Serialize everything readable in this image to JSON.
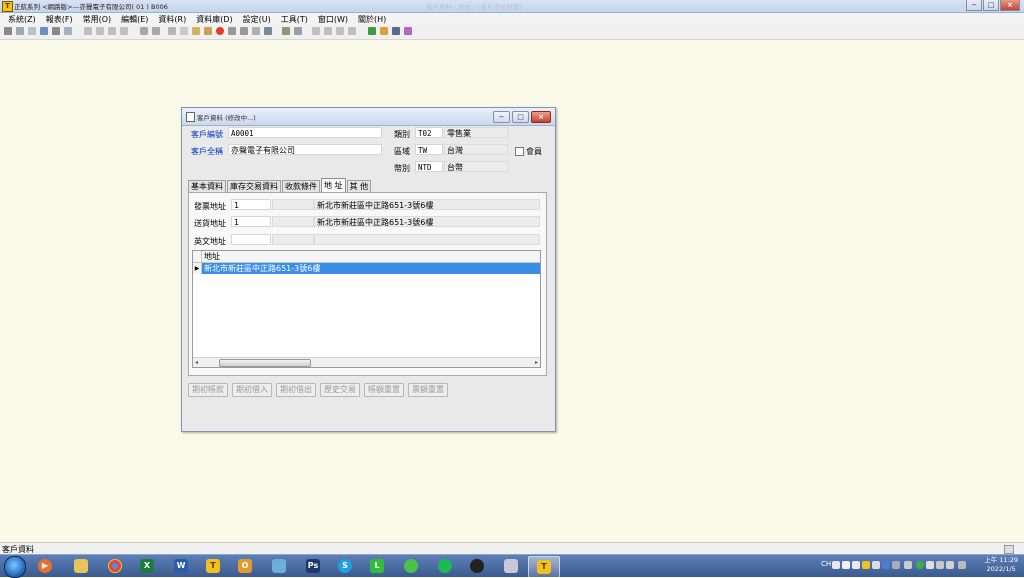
{
  "window": {
    "title": "正航系列 <網路版>---亦聲電子有限公司( 01 ) B006",
    "ghost_title": "客戶資料 - 地址 - [客戶地址維護]",
    "buttons": [
      "−",
      "□",
      "×"
    ]
  },
  "menu": [
    "系統(Z)",
    "報表(F)",
    "常用(O)",
    "編輯(E)",
    "資料(R)",
    "資料庫(D)",
    "設定(U)",
    "工具(T)",
    "窗口(W)",
    "關於(H)"
  ],
  "dialog": {
    "title": "客戶資料 (修改中...)",
    "buttons": [
      "−",
      "□",
      "×"
    ],
    "customer_no_label": "客戶編號",
    "customer_no": "A0001",
    "customer_name_label": "客戶全稱",
    "customer_name": "亦聲電子有限公司",
    "category_label": "類別",
    "category_code": "T02",
    "category_name": "零售業",
    "region_label": "區域",
    "region_code": "TW",
    "region_name": "台灣",
    "currency_label": "幣別",
    "currency_code": "NTD",
    "currency_name": "台幣",
    "member_label": "會員",
    "tabs": [
      "基本資料",
      "庫存交易資料",
      "收款條件",
      "地  址",
      "其  他"
    ],
    "active_tab": "地  址",
    "address": {
      "invoice_label": "發票地址",
      "invoice_code": "1",
      "invoice_address": "新北市新莊區中正路651-3號6樓",
      "delivery_label": "送貨地址",
      "delivery_code": "1",
      "delivery_address": "新北市新莊區中正路651-3號6樓",
      "english_label": "英文地址",
      "english_code": "",
      "english_address": ""
    },
    "grid": {
      "column": "地址",
      "rows": [
        "新北市新莊區中正路651-3號6樓"
      ]
    },
    "action_buttons": [
      "期初帳款",
      "期初借入",
      "期初借出",
      "歷史交易",
      "帳額重置",
      "票額重置"
    ]
  },
  "status": {
    "text": "客戶資料"
  },
  "taskbar": {
    "lang": "CH",
    "time": "上午 11:29",
    "date": "2022/1/5"
  }
}
